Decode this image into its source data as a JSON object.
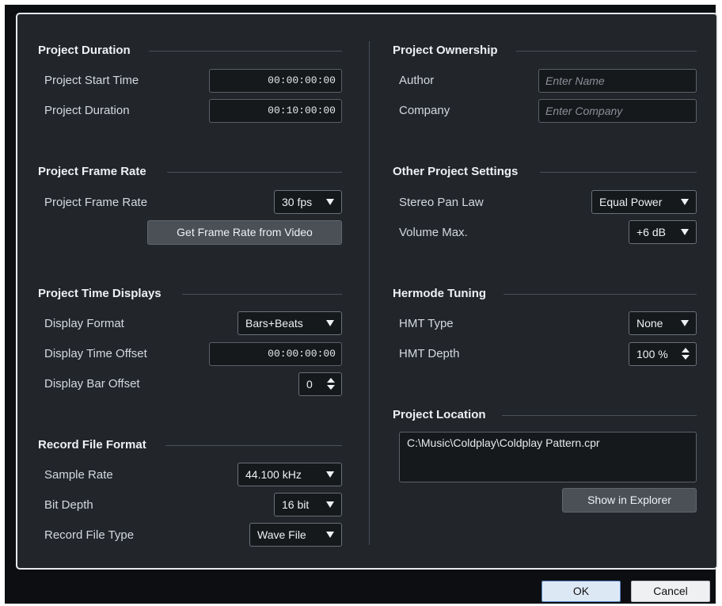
{
  "colors": {
    "dialog_bg": "#0c0e11",
    "panel_bg": "#22262b",
    "field_bg": "#16191c",
    "button_bg": "#4b5057",
    "ok_bg": "#dde8f5",
    "cancel_bg": "#eef0f2"
  },
  "sections": {
    "duration": {
      "title": "Project Duration",
      "start_label": "Project Start Time",
      "start_value": "00:00:00:00",
      "duration_label": "Project Duration",
      "duration_value": "00:10:00:00"
    },
    "frame_rate": {
      "title": "Project Frame Rate",
      "label": "Project Frame Rate",
      "value": "30 fps",
      "button": "Get Frame Rate from Video"
    },
    "time_displays": {
      "title": "Project Time Displays",
      "format_label": "Display Format",
      "format_value": "Bars+Beats",
      "offset_label": "Display Time Offset",
      "offset_value": "00:00:00:00",
      "bar_offset_label": "Display Bar Offset",
      "bar_offset_value": "0"
    },
    "record_format": {
      "title": "Record File Format",
      "sample_rate_label": "Sample Rate",
      "sample_rate_value": "44.100 kHz",
      "bit_depth_label": "Bit Depth",
      "bit_depth_value": "16 bit",
      "file_type_label": "Record File Type",
      "file_type_value": "Wave File"
    },
    "ownership": {
      "title": "Project Ownership",
      "author_label": "Author",
      "author_placeholder": "Enter Name",
      "company_label": "Company",
      "company_placeholder": "Enter Company"
    },
    "other": {
      "title": "Other Project Settings",
      "pan_law_label": "Stereo Pan Law",
      "pan_law_value": "Equal Power",
      "volume_label": "Volume Max.",
      "volume_value": "+6 dB"
    },
    "hermode": {
      "title": "Hermode Tuning",
      "type_label": "HMT Type",
      "type_value": "None",
      "depth_label": "HMT Depth",
      "depth_value": "100 %"
    },
    "location": {
      "title": "Project Location",
      "path": "C:\\Music\\Coldplay\\Coldplay Pattern.cpr",
      "button": "Show in Explorer"
    }
  },
  "footer": {
    "ok": "OK",
    "cancel": "Cancel"
  }
}
